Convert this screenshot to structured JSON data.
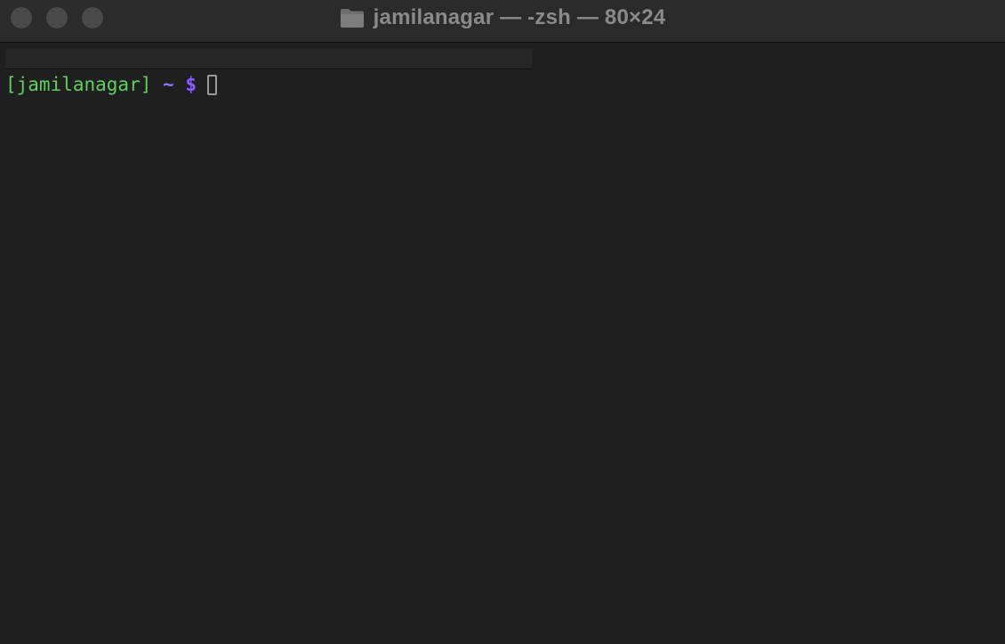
{
  "window": {
    "title": "jamilanagar — -zsh — 80×24",
    "title_icon": "folder-icon",
    "traffic_lights": [
      "close",
      "minimize",
      "zoom"
    ],
    "inactive_color": "#4a4a4a"
  },
  "terminal": {
    "background": "#1f1f1f",
    "prompt": {
      "user_segment": "[jamilanagar]",
      "tilde": "~",
      "symbol": "$",
      "user_color": "#5fd05f",
      "symbol_color": "#8b5cff"
    },
    "input": ""
  }
}
